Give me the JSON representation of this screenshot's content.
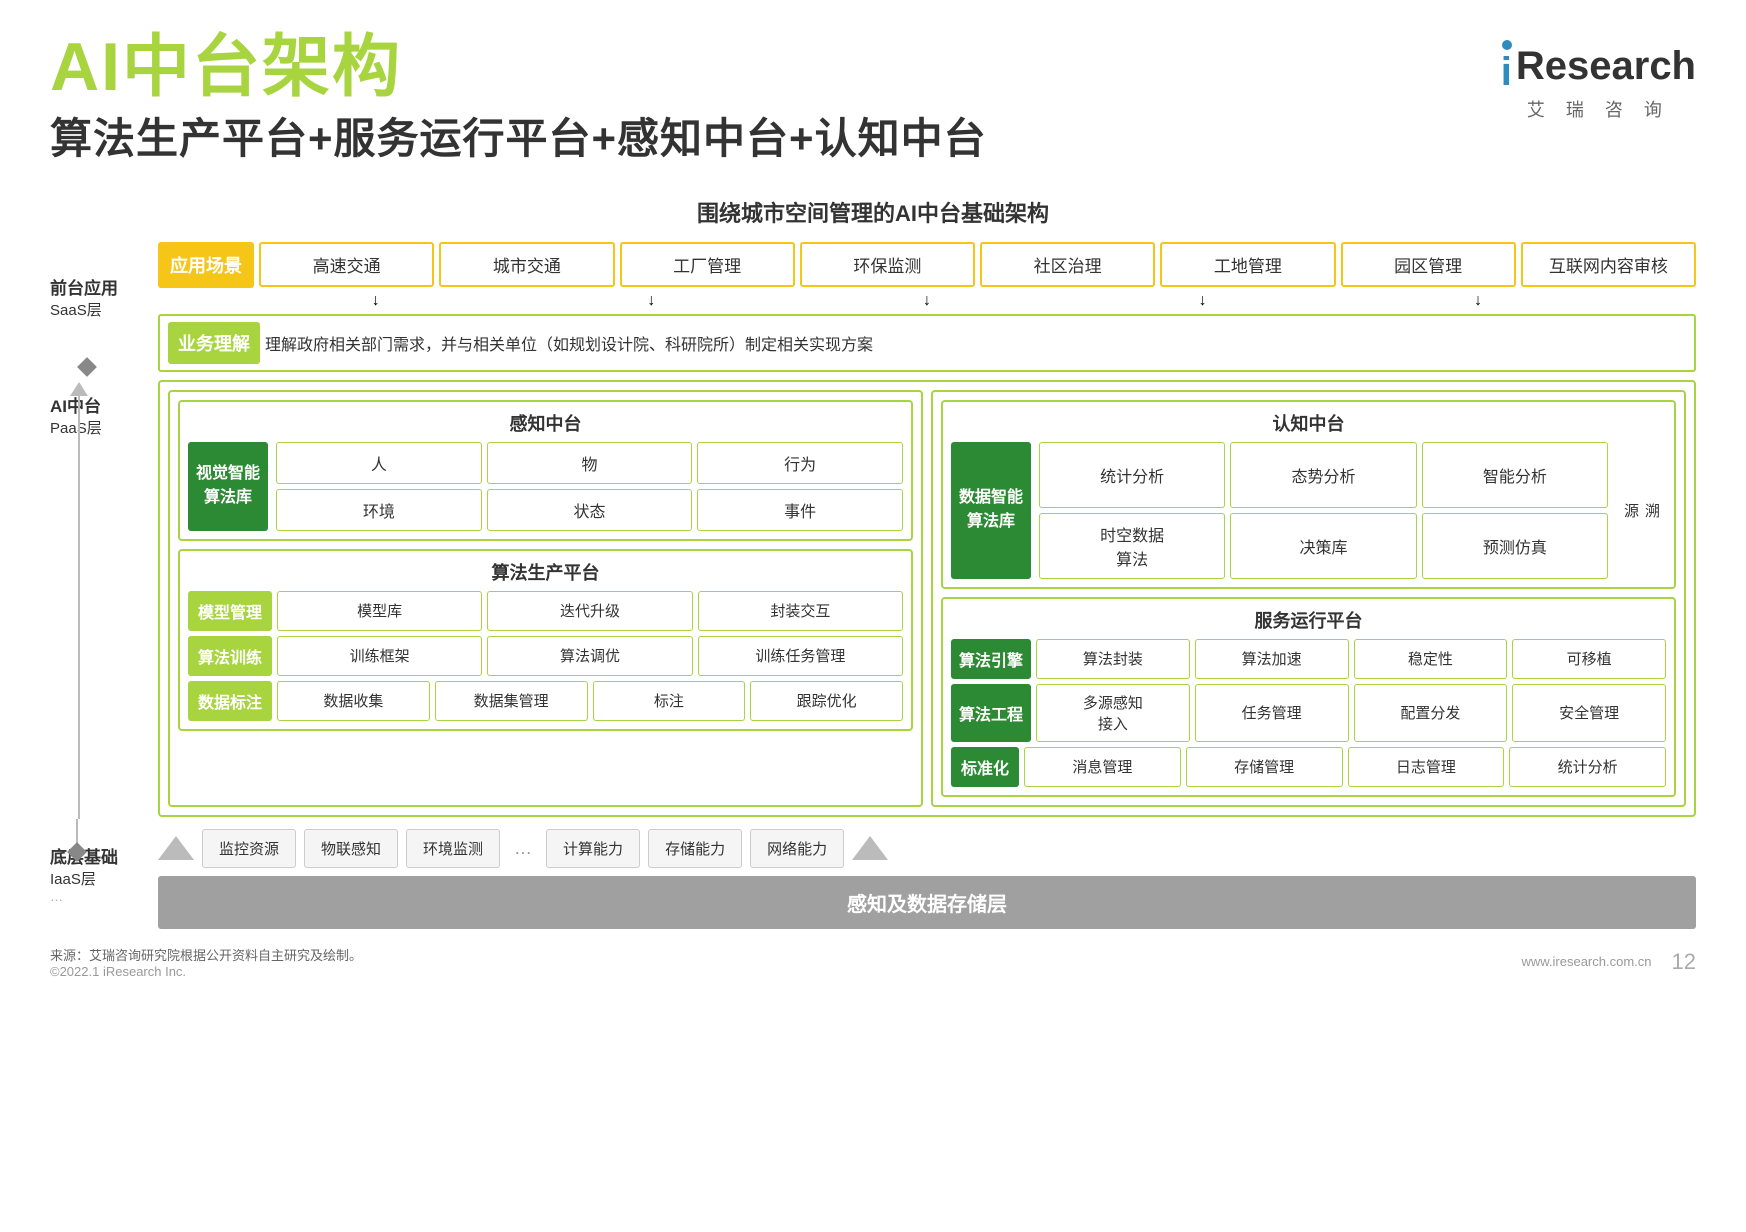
{
  "page": {
    "title": "AI中台架构",
    "subtitle": "算法生产平台+服务运行平台+感知中台+认知中台",
    "diagram_title": "围绕城市空间管理的AI中台基础架构",
    "source": "来源：艾瑞咨询研究院根据公开资料自主研究及绘制。",
    "copyright": "©2022.1 iResearch Inc.",
    "website": "www.iresearch.com.cn",
    "page_number": "12"
  },
  "logo": {
    "text": "iResearch",
    "sub": "艾  瑞  咨  询"
  },
  "left_labels": {
    "saas": {
      "line1": "前台应用",
      "line2": "SaaS层"
    },
    "paas": {
      "line1": "AI中台",
      "line2": "PaaS层"
    },
    "iaas": {
      "line1": "底层基础",
      "line2": "IaaS层"
    }
  },
  "saas_layer": {
    "application_label": "应用场景",
    "apps": [
      "高速交通",
      "城市交通",
      "工厂管理",
      "环保监测",
      "社区治理",
      "工地管理",
      "园区管理",
      "互联网内容审核"
    ],
    "business_label": "业务理解",
    "business_text": "理解政府相关部门需求，并与相关单位（如规划设计院、科研院所）制定相关实现方案"
  },
  "paas_layer": {
    "perception": {
      "title": "感知中台",
      "algo_library": "视觉智能\n算法库",
      "grid": [
        "人",
        "物",
        "行为",
        "环境",
        "状态",
        "事件"
      ]
    },
    "cognition": {
      "title": "认知中台",
      "algo_library": "数据智能\n算法库",
      "grid_row1": [
        "统计分析",
        "态势分析",
        "智能分析"
      ],
      "grid_row2": [
        "时空数据\n算法",
        "决策库",
        "预测仿真"
      ],
      "tracing": "溯\n源"
    },
    "algo_platform": {
      "title": "算法生产平台",
      "rows": [
        {
          "label": "模型管理",
          "items": [
            "模型库",
            "迭代升级",
            "封装交互"
          ]
        },
        {
          "label": "算法训练",
          "items": [
            "训练框架",
            "算法调优",
            "训练任务管理"
          ]
        },
        {
          "label": "数据标注",
          "items": [
            "数据收集",
            "数据集管理",
            "标注",
            "跟踪优化"
          ]
        }
      ]
    },
    "service_platform": {
      "title": "服务运行平台",
      "rows": [
        {
          "label": "算法引擎",
          "label_type": "dark",
          "items": [
            "算法封装",
            "算法加速",
            "稳定性",
            "可移植"
          ]
        },
        {
          "label": "算法工程",
          "label_type": "dark",
          "items": [
            "多源感知\n接入",
            "任务管理",
            "配置分发",
            "安全管理"
          ]
        },
        {
          "label": "标准化",
          "label_type": "dark",
          "items": [
            "消息管理",
            "存储管理",
            "日志管理",
            "统计分析"
          ]
        }
      ]
    }
  },
  "iaas_layer": {
    "infra_items": [
      "监控资源",
      "物联感知",
      "环境监测",
      "计算能力",
      "存储能力",
      "网络能力"
    ],
    "storage_label": "感知及数据存储层"
  }
}
